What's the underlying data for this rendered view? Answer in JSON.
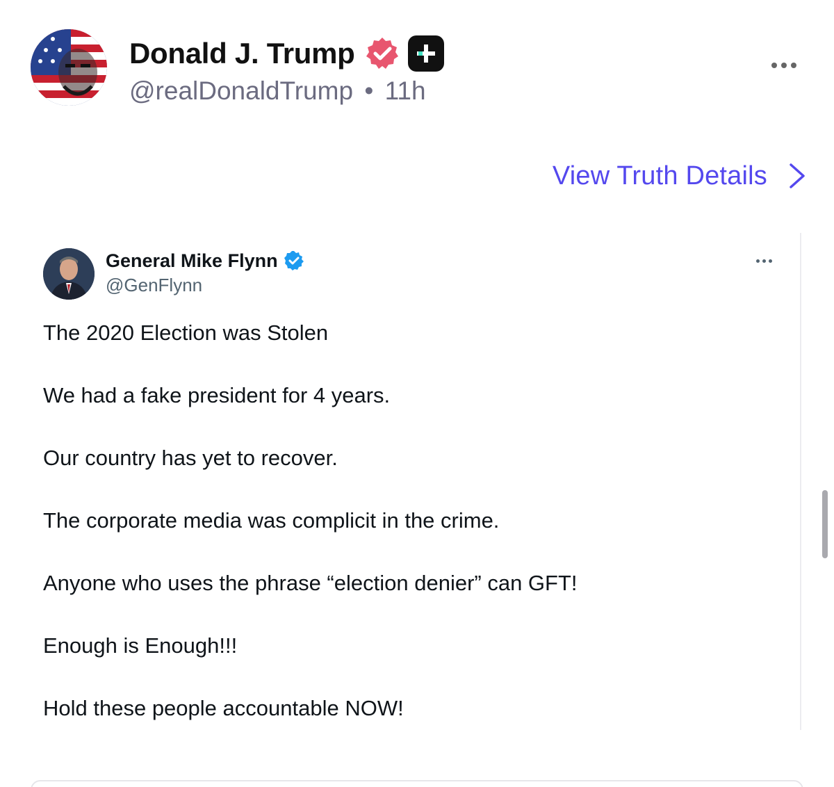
{
  "post": {
    "author": "Donald J. Trump",
    "handle": "@realDonaldTrump",
    "separator": "•",
    "time": "11h",
    "view_details": "View Truth Details"
  },
  "embedded_tweet": {
    "author": "General Mike Flynn",
    "handle": "@GenFlynn",
    "lines": [
      "The 2020 Election was Stolen",
      "We had a fake president for 4 years.",
      "Our country has yet to recover.",
      "The corporate media was complicit in the crime.",
      "Anyone who uses the phrase “election denier” can GFT!",
      "Enough is Enough!!!",
      "Hold these people accountable NOW!"
    ]
  },
  "icons": {
    "verified_truth": "verified-badge-icon",
    "plus_badge": "plus-badge-icon",
    "more_post": "more-options-icon",
    "view_details_chevron": "chevron-right-icon",
    "verified_tweet": "verified-check-icon",
    "more_tweet": "more-options-icon"
  },
  "colors": {
    "accent": "#5448ee",
    "verified_truth": "#e8566f",
    "verified_tweet": "#1d9bf0",
    "muted_text": "#6b6b80"
  }
}
